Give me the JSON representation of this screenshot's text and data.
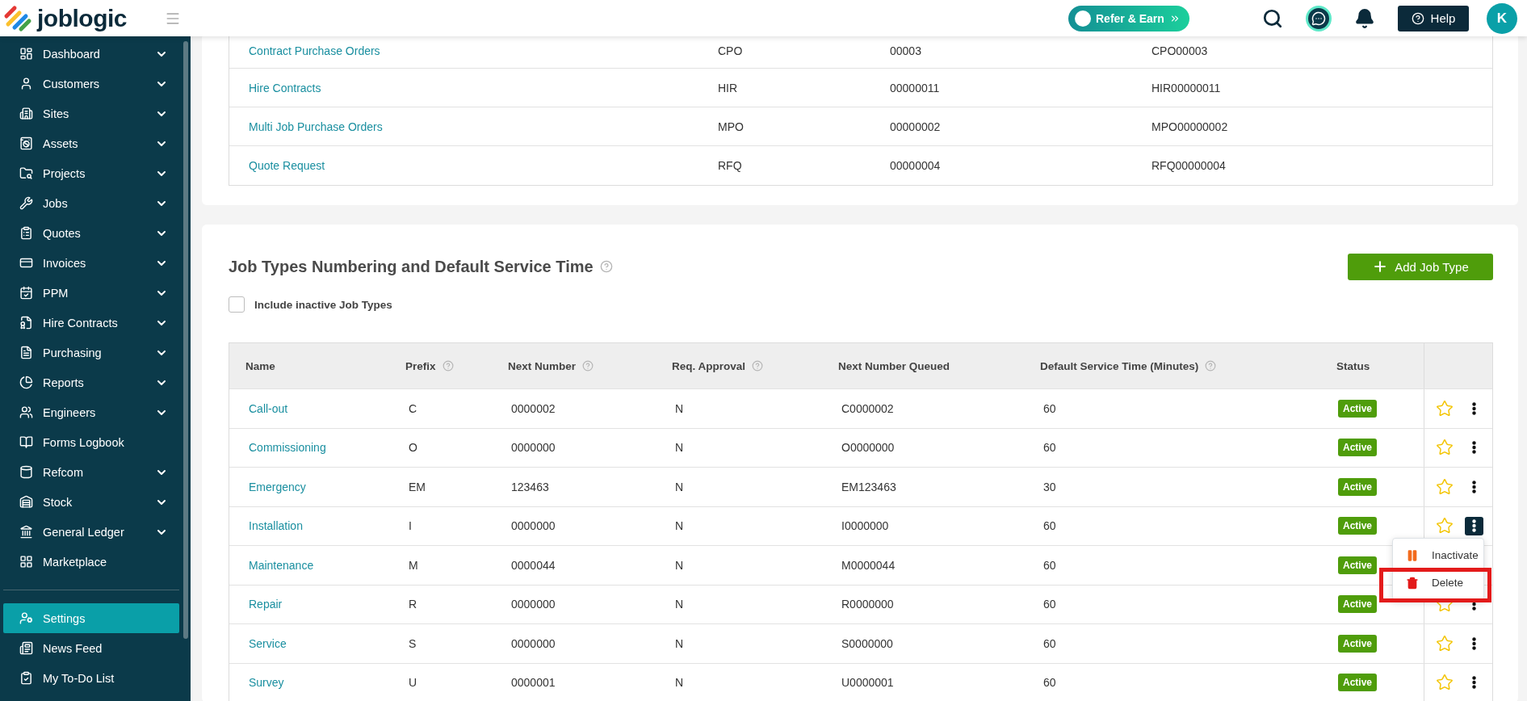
{
  "topbar": {
    "logo": "joblogic",
    "refer_button": "Refer & Earn",
    "help_button": "Help",
    "avatar": "K"
  },
  "sidebar": {
    "items": [
      {
        "label": "Dashboard",
        "expandable": true,
        "selected": false
      },
      {
        "label": "Customers",
        "expandable": true,
        "selected": false
      },
      {
        "label": "Sites",
        "expandable": true,
        "selected": false
      },
      {
        "label": "Assets",
        "expandable": true,
        "selected": false
      },
      {
        "label": "Projects",
        "expandable": true,
        "selected": false
      },
      {
        "label": "Jobs",
        "expandable": true,
        "selected": false
      },
      {
        "label": "Quotes",
        "expandable": true,
        "selected": false
      },
      {
        "label": "Invoices",
        "expandable": true,
        "selected": false
      },
      {
        "label": "PPM",
        "expandable": true,
        "selected": false
      },
      {
        "label": "Hire Contracts",
        "expandable": true,
        "selected": false
      },
      {
        "label": "Purchasing",
        "expandable": true,
        "selected": false
      },
      {
        "label": "Reports",
        "expandable": true,
        "selected": false
      },
      {
        "label": "Engineers",
        "expandable": true,
        "selected": false
      },
      {
        "label": "Forms Logbook",
        "expandable": false,
        "selected": false
      },
      {
        "label": "Refcom",
        "expandable": true,
        "selected": false
      },
      {
        "label": "Stock",
        "expandable": true,
        "selected": false
      },
      {
        "label": "General Ledger",
        "expandable": true,
        "selected": false
      },
      {
        "label": "Marketplace",
        "expandable": false,
        "selected": false
      }
    ],
    "bottom_items": [
      {
        "label": "Settings",
        "selected": true
      },
      {
        "label": "News Feed",
        "selected": false
      },
      {
        "label": "My To-Do List",
        "selected": false
      }
    ]
  },
  "numbering_table": {
    "rows": [
      {
        "name": "Contract Purchase Orders",
        "prefix": "CPO",
        "next_number": "00003",
        "full_number": "CPO00003"
      },
      {
        "name": "Hire Contracts",
        "prefix": "HIR",
        "next_number": "00000011",
        "full_number": "HIR00000011"
      },
      {
        "name": "Multi Job Purchase Orders",
        "prefix": "MPO",
        "next_number": "00000002",
        "full_number": "MPO00000002"
      },
      {
        "name": "Quote Request",
        "prefix": "RFQ",
        "next_number": "00000004",
        "full_number": "RFQ00000004"
      }
    ]
  },
  "job_types": {
    "title": "Job Types Numbering and Default Service Time",
    "add_button": "Add Job Type",
    "include_inactive": {
      "label": "Include inactive Job Types",
      "checked": false
    },
    "columns": [
      {
        "label": "Name",
        "help": false
      },
      {
        "label": "Prefix",
        "help": true
      },
      {
        "label": "Next Number",
        "help": true
      },
      {
        "label": "Req. Approval",
        "help": true
      },
      {
        "label": "Next Number Queued",
        "help": false
      },
      {
        "label": "Default Service Time (Minutes)",
        "help": true
      },
      {
        "label": "Status",
        "help": false
      }
    ],
    "rows": [
      {
        "name": "Call-out",
        "prefix": "C",
        "next_number": "0000002",
        "req_approval": "N",
        "next_queued": "C0000002",
        "service_time": "60",
        "status": "Active",
        "active": true,
        "favourite": false,
        "menu_open": false
      },
      {
        "name": "Commissioning",
        "prefix": "O",
        "next_number": "0000000",
        "req_approval": "N",
        "next_queued": "O0000000",
        "service_time": "60",
        "status": "Active",
        "active": true,
        "favourite": false,
        "menu_open": false
      },
      {
        "name": "Emergency",
        "prefix": "EM",
        "next_number": "123463",
        "req_approval": "N",
        "next_queued": "EM123463",
        "service_time": "30",
        "status": "Active",
        "active": true,
        "favourite": false,
        "menu_open": false
      },
      {
        "name": "Installation",
        "prefix": "I",
        "next_number": "0000000",
        "req_approval": "N",
        "next_queued": "I0000000",
        "service_time": "60",
        "status": "Active",
        "active": true,
        "favourite": false,
        "menu_open": true
      },
      {
        "name": "Maintenance",
        "prefix": "M",
        "next_number": "0000044",
        "req_approval": "N",
        "next_queued": "M0000044",
        "service_time": "60",
        "status": "Active",
        "active": true
      },
      {
        "name": "Repair",
        "prefix": "R",
        "next_number": "0000000",
        "req_approval": "N",
        "next_queued": "R0000000",
        "service_time": "60",
        "status": "Active",
        "active": true,
        "favourite": false,
        "menu_open": false
      },
      {
        "name": "Service",
        "prefix": "S",
        "next_number": "0000000",
        "req_approval": "N",
        "next_queued": "S0000000",
        "service_time": "60",
        "status": "Active",
        "active": true,
        "favourite": false,
        "menu_open": false
      },
      {
        "name": "Survey",
        "prefix": "U",
        "next_number": "0000001",
        "req_approval": "N",
        "next_queued": "U0000001",
        "service_time": "60",
        "status": "Active",
        "active": true,
        "favourite": false,
        "menu_open": false
      }
    ],
    "menu": {
      "items": [
        {
          "label": "Inactivate",
          "kind": "inactivate",
          "highlighted": false
        },
        {
          "label": "Delete",
          "kind": "delete",
          "highlighted": true
        }
      ]
    }
  }
}
